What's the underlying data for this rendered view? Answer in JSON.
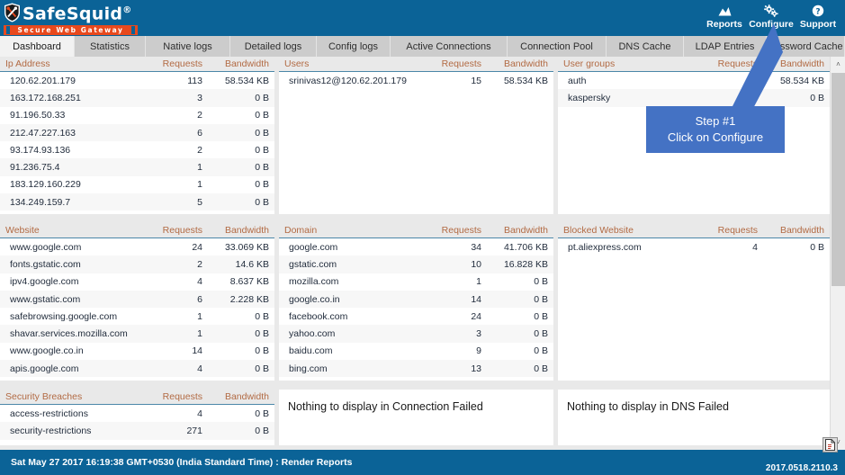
{
  "brand": {
    "name": "SafeSquid",
    "registered": "®",
    "tagline": "Secure Web Gateway",
    "shield_icon": "shield-tools-icon",
    "header_bg": "#0b6397",
    "tagline_bg": "#e8491d"
  },
  "header": {
    "actions": [
      {
        "label": "Reports",
        "icon": "chart-icon"
      },
      {
        "label": "Configure",
        "icon": "gears-icon"
      },
      {
        "label": "Support",
        "icon": "help-circle-icon"
      }
    ]
  },
  "tabs": [
    {
      "label": "Dashboard",
      "active": true
    },
    {
      "label": "Statistics",
      "active": false
    },
    {
      "label": "Native logs",
      "active": false
    },
    {
      "label": "Detailed logs",
      "active": false
    },
    {
      "label": "Config logs",
      "active": false
    },
    {
      "label": "Active Connections",
      "active": false
    },
    {
      "label": "Connection Pool",
      "active": false
    },
    {
      "label": "DNS Cache",
      "active": false
    },
    {
      "label": "LDAP Entries",
      "active": false
    },
    {
      "label": "Password Cache",
      "active": false
    }
  ],
  "columns": {
    "requests": "Requests",
    "bandwidth": "Bandwidth"
  },
  "panels": {
    "ip_address": {
      "title": "Ip Address",
      "rows": [
        {
          "name": "120.62.201.179",
          "requests": "113",
          "bandwidth": "58.534 KB"
        },
        {
          "name": "163.172.168.251",
          "requests": "3",
          "bandwidth": "0 B"
        },
        {
          "name": "91.196.50.33",
          "requests": "2",
          "bandwidth": "0 B"
        },
        {
          "name": "212.47.227.163",
          "requests": "6",
          "bandwidth": "0 B"
        },
        {
          "name": "93.174.93.136",
          "requests": "2",
          "bandwidth": "0 B"
        },
        {
          "name": "91.236.75.4",
          "requests": "1",
          "bandwidth": "0 B"
        },
        {
          "name": "183.129.160.229",
          "requests": "1",
          "bandwidth": "0 B"
        },
        {
          "name": "134.249.159.7",
          "requests": "5",
          "bandwidth": "0 B"
        }
      ]
    },
    "users": {
      "title": "Users",
      "rows": [
        {
          "name": "srinivas12@120.62.201.179",
          "requests": "15",
          "bandwidth": "58.534 KB"
        }
      ]
    },
    "user_groups": {
      "title": "User groups",
      "rows": [
        {
          "name": "auth",
          "requests": "",
          "bandwidth": "58.534 KB"
        },
        {
          "name": "kaspersky",
          "requests": "",
          "bandwidth": "0 B"
        }
      ]
    },
    "website": {
      "title": "Website",
      "rows": [
        {
          "name": "www.google.com",
          "requests": "24",
          "bandwidth": "33.069 KB"
        },
        {
          "name": "fonts.gstatic.com",
          "requests": "2",
          "bandwidth": "14.6 KB"
        },
        {
          "name": "ipv4.google.com",
          "requests": "4",
          "bandwidth": "8.637 KB"
        },
        {
          "name": "www.gstatic.com",
          "requests": "6",
          "bandwidth": "2.228 KB"
        },
        {
          "name": "safebrowsing.google.com",
          "requests": "1",
          "bandwidth": "0 B"
        },
        {
          "name": "shavar.services.mozilla.com",
          "requests": "1",
          "bandwidth": "0 B"
        },
        {
          "name": "www.google.co.in",
          "requests": "14",
          "bandwidth": "0 B"
        },
        {
          "name": "apis.google.com",
          "requests": "4",
          "bandwidth": "0 B"
        }
      ]
    },
    "domain": {
      "title": "Domain",
      "rows": [
        {
          "name": "google.com",
          "requests": "34",
          "bandwidth": "41.706 KB"
        },
        {
          "name": "gstatic.com",
          "requests": "10",
          "bandwidth": "16.828 KB"
        },
        {
          "name": "mozilla.com",
          "requests": "1",
          "bandwidth": "0 B"
        },
        {
          "name": "google.co.in",
          "requests": "14",
          "bandwidth": "0 B"
        },
        {
          "name": "facebook.com",
          "requests": "24",
          "bandwidth": "0 B"
        },
        {
          "name": "yahoo.com",
          "requests": "3",
          "bandwidth": "0 B"
        },
        {
          "name": "baidu.com",
          "requests": "9",
          "bandwidth": "0 B"
        },
        {
          "name": "bing.com",
          "requests": "13",
          "bandwidth": "0 B"
        }
      ]
    },
    "blocked_website": {
      "title": "Blocked Website",
      "rows": [
        {
          "name": "pt.aliexpress.com",
          "requests": "4",
          "bandwidth": "0 B"
        }
      ]
    },
    "security_breaches": {
      "title": "Security Breaches",
      "rows": [
        {
          "name": "access-restrictions",
          "requests": "4",
          "bandwidth": "0 B"
        },
        {
          "name": "security-restrictions",
          "requests": "271",
          "bandwidth": "0 B"
        }
      ]
    },
    "connection_failed": {
      "message": "Nothing to display in Connection Failed"
    },
    "dns_failed": {
      "message": "Nothing to display in DNS Failed"
    }
  },
  "callout": {
    "line1": "Step #1",
    "line2": "Click on Configure",
    "color": "#4472c4"
  },
  "footer": {
    "status": "Sat May 27 2017 16:19:38 GMT+0530 (India Standard Time) : Render Reports",
    "version": "2017.0518.2110.3",
    "export_icon": "pdf-export-icon"
  },
  "scrollbar": {
    "up": "˄",
    "down": "˅"
  }
}
